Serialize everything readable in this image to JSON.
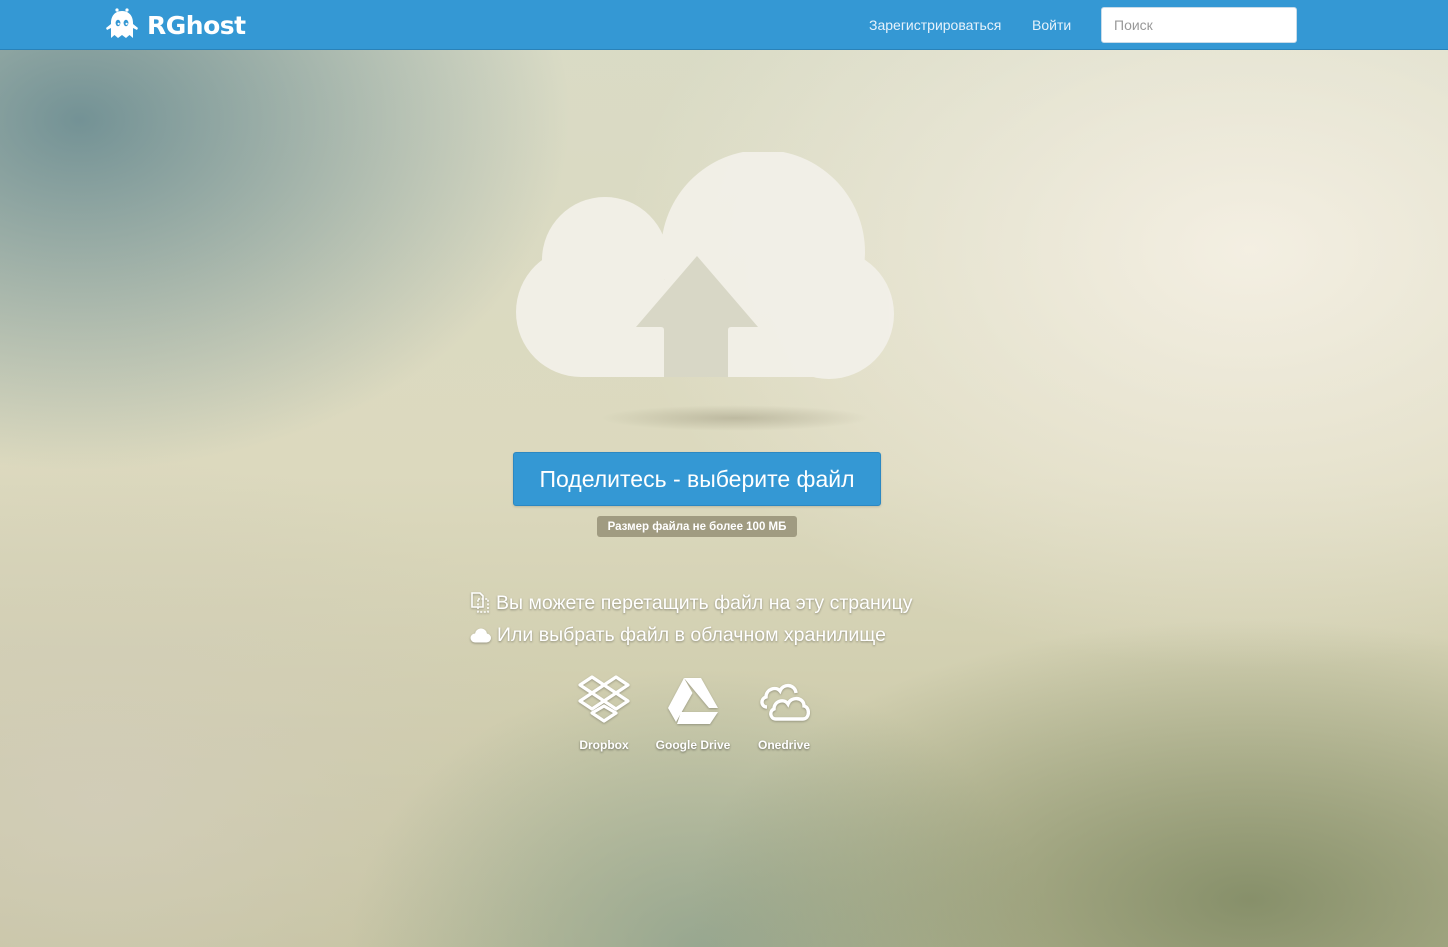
{
  "header": {
    "brand": "RGhost",
    "register_label": "Зарегистрироваться",
    "login_label": "Войти",
    "search_placeholder": "Поиск"
  },
  "upload": {
    "icon": "cloud-upload-icon",
    "button_label": "Поделитесь - выберите файл",
    "size_limit": "Размер файла не более 100 МБ"
  },
  "hints": {
    "drag_text": "Вы можете перетащить файл на эту страницу",
    "drag_icon": "drag-file-icon",
    "cloud_text": "Или выбрать файл в облачном хранилище",
    "cloud_icon": "cloud-icon"
  },
  "services": [
    {
      "label": "Dropbox",
      "icon": "dropbox-icon"
    },
    {
      "label": "Google Drive",
      "icon": "google-drive-icon"
    },
    {
      "label": "Onedrive",
      "icon": "onedrive-icon"
    }
  ],
  "colors": {
    "accent": "#3498d4",
    "text_on_accent": "#ffffff"
  }
}
